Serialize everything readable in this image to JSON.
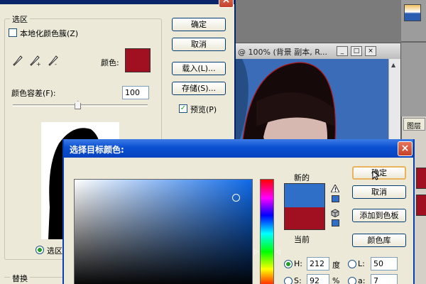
{
  "color_range_dialog": {
    "selection_group_label": "选区",
    "localized_clusters_label": "本地化颜色簇(Z)",
    "color_label": "颜色:",
    "sampled_color": "#a01020",
    "fuzziness_label": "颜色容差(F):",
    "fuzziness_value": "100",
    "fuzziness_slider_level": 0.48,
    "ok_label": "确定",
    "cancel_label": "取消",
    "load_label": "载入(L)...",
    "save_label": "存储(S)...",
    "preview_label": "预览(P)",
    "preview_checked": true,
    "selection_radio_label": "选区",
    "invert_label": "替换"
  },
  "document_window": {
    "title": "@ 100% (背景 副本, R..."
  },
  "layers_panel": {
    "tab_label": "图层"
  },
  "color_picker": {
    "title": "选择目标颜色:",
    "ok_label": "确定",
    "cancel_label": "取消",
    "add_swatch_label": "添加到色板",
    "color_libraries_label": "颜色库",
    "new_label": "新的",
    "current_label": "当前",
    "new_color": "#2f6fc8",
    "current_color": "#a01020",
    "warning_icon": "gamut-warning-icon",
    "websafe_icon": "web-cube-icon",
    "h_label": "H:",
    "h_value": "212",
    "h_unit": "度",
    "s_label": "S:",
    "s_value": "92",
    "s_unit": "%",
    "l_label": "L:",
    "l_value": "50",
    "a_label": "a:",
    "a_value": "7"
  }
}
